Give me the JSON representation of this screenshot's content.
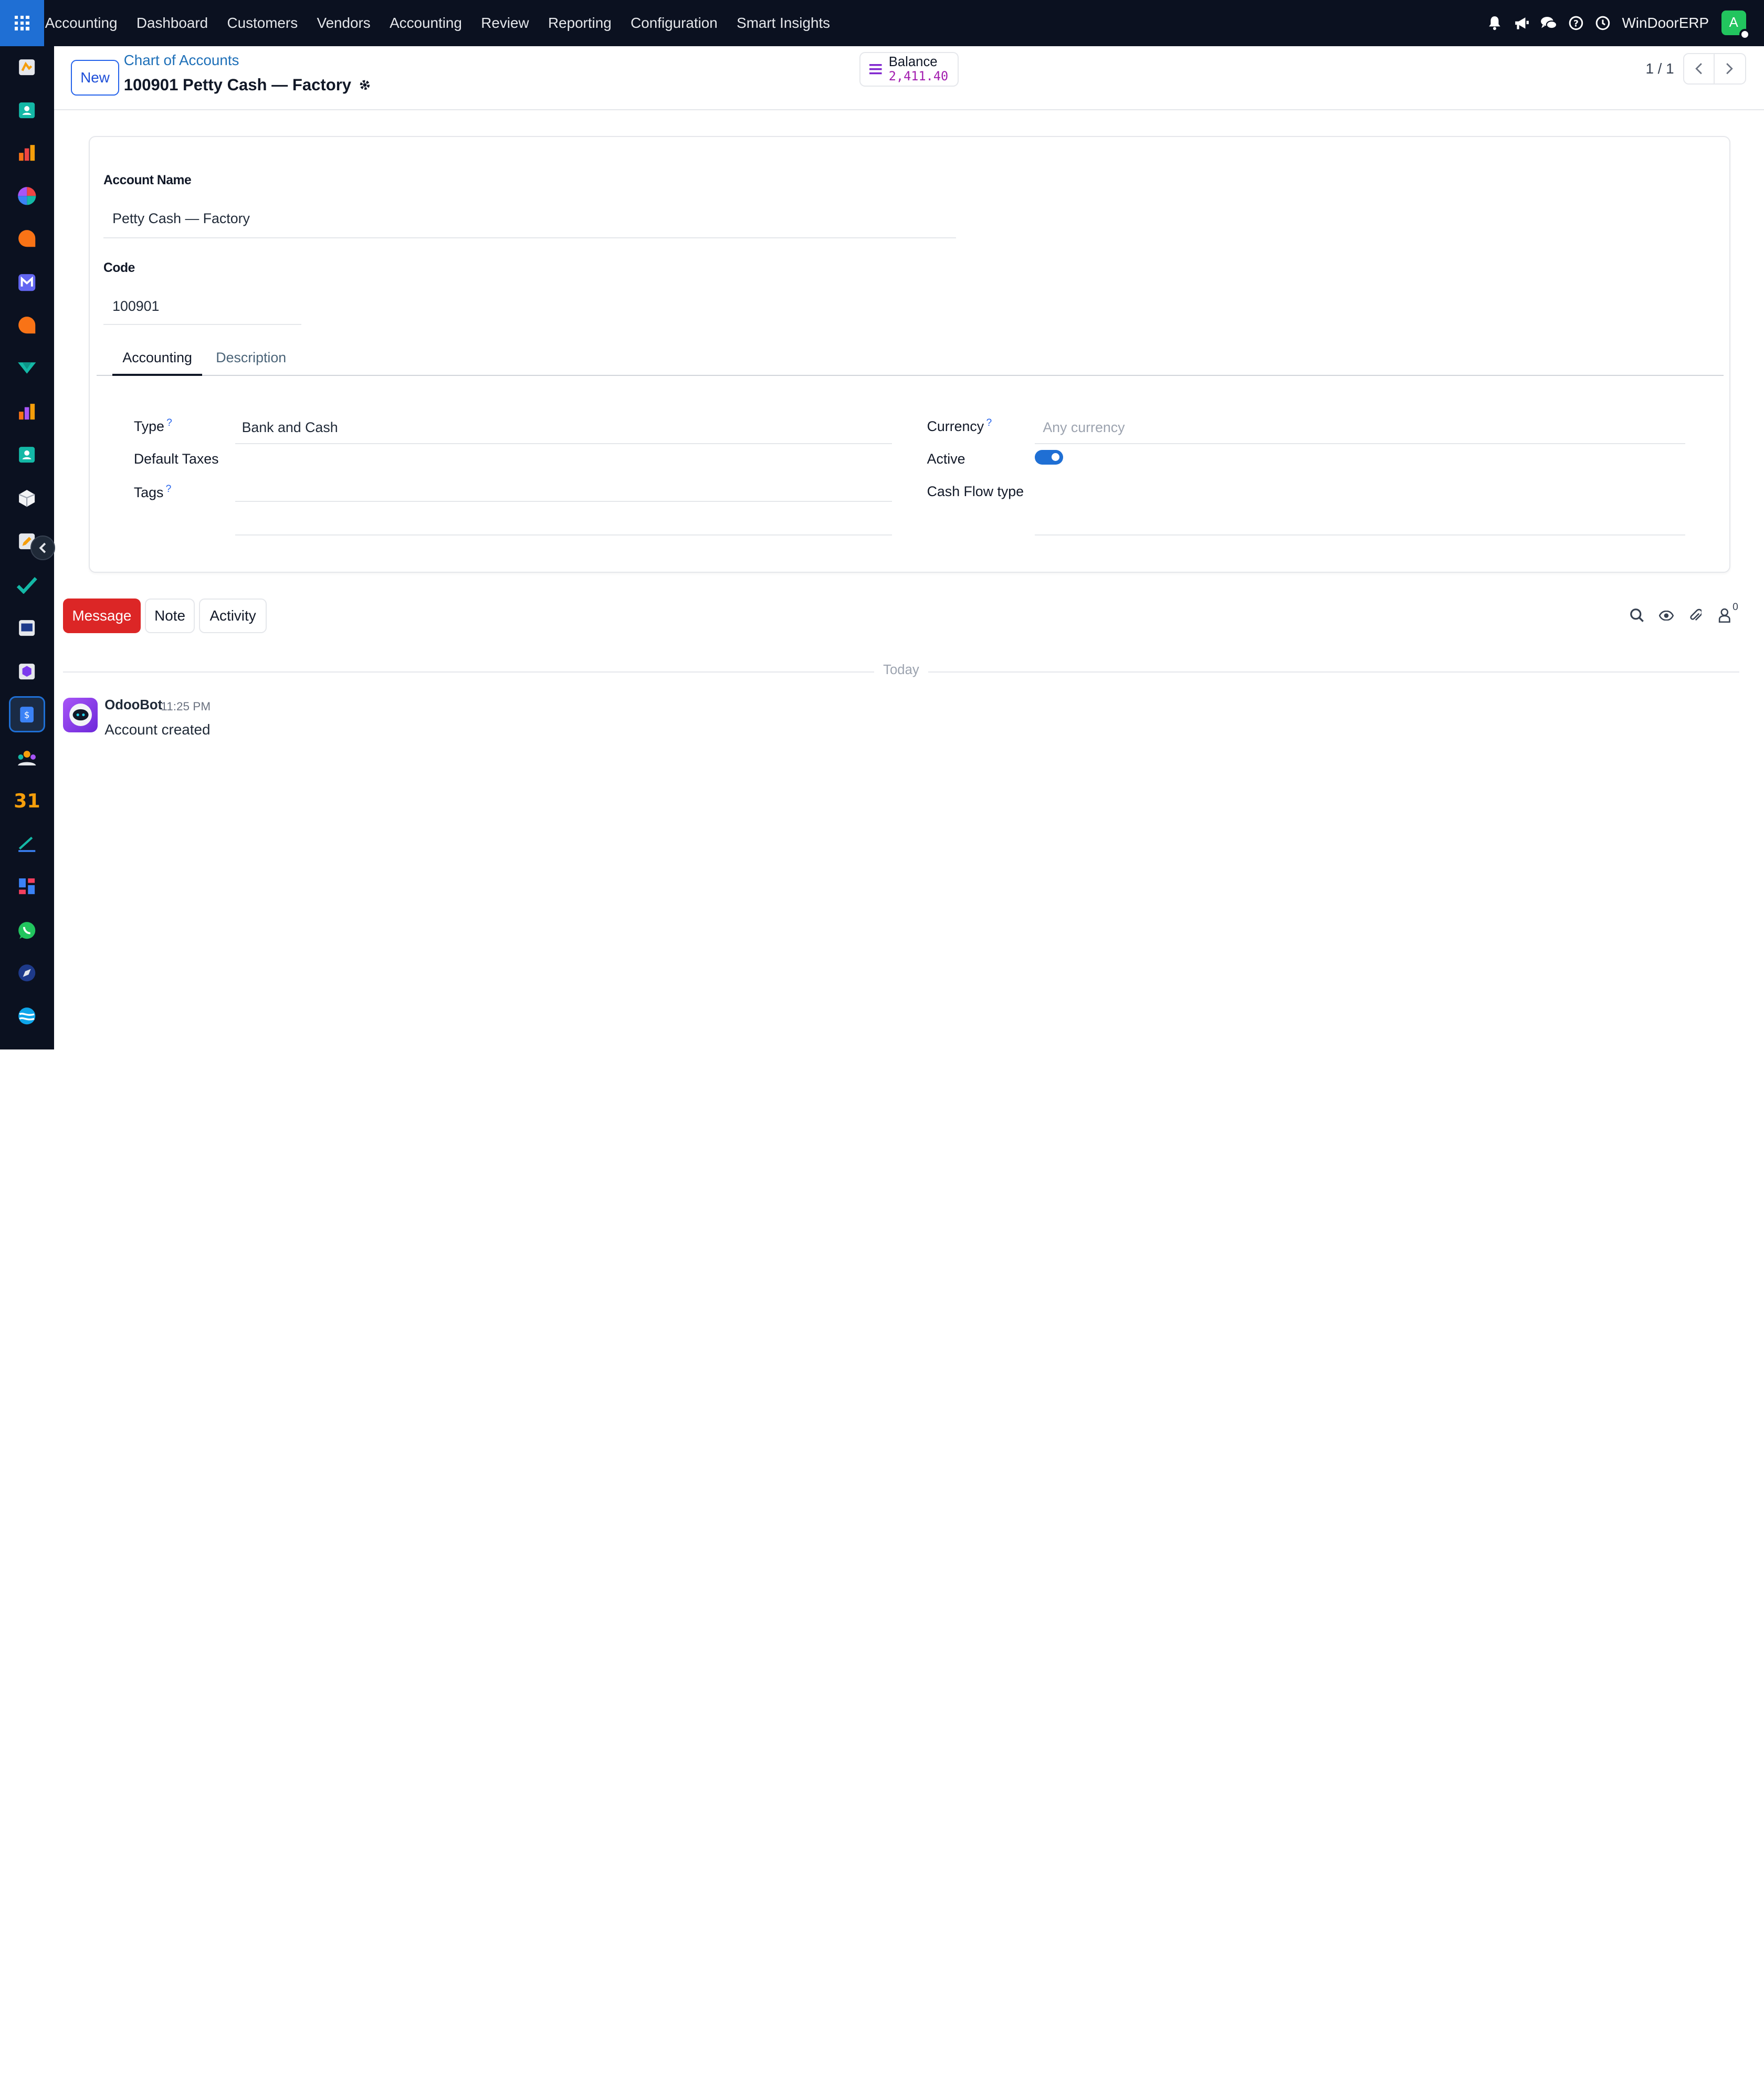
{
  "navbar": {
    "menu": [
      "Accounting",
      "Dashboard",
      "Customers",
      "Vendors",
      "Accounting",
      "Review",
      "Reporting",
      "Configuration",
      "Smart Insights"
    ],
    "company": "WinDoorERP",
    "avatar_initial": "A"
  },
  "control_panel": {
    "new_label": "New",
    "breadcrumb": "Chart of Accounts",
    "title": "100901 Petty Cash — Factory",
    "balance_label": "Balance",
    "balance_value": "2,411.40",
    "pager": "1 / 1"
  },
  "form": {
    "name_label": "Account Name",
    "name_value": "Petty Cash — Factory",
    "code_label": "Code",
    "code_value": "100901",
    "tabs": [
      "Accounting",
      "Description"
    ],
    "type_label": "Type",
    "type_value": "Bank and Cash",
    "default_taxes_label": "Default Taxes",
    "tags_label": "Tags",
    "currency_label": "Currency",
    "currency_placeholder": "Any currency",
    "active_label": "Active",
    "active": true,
    "cash_flow_label": "Cash Flow type",
    "help_mark": "?"
  },
  "chatter": {
    "message_label": "Message",
    "note_label": "Note",
    "activity_label": "Activity",
    "follower_count": "0",
    "date_separator": "Today",
    "messages": [
      {
        "author": "OdooBot",
        "time": "11:25 PM",
        "body": "Account created"
      }
    ]
  },
  "colors": {
    "navbar_bg": "#0b1120",
    "apps_button": "#1f6fd4",
    "primary_link": "#1d6fb8",
    "message_button": "#dc2626",
    "avatar": "#22c55e",
    "balance_value": "#a21caf",
    "toggle_on": "#1f6fd4"
  }
}
